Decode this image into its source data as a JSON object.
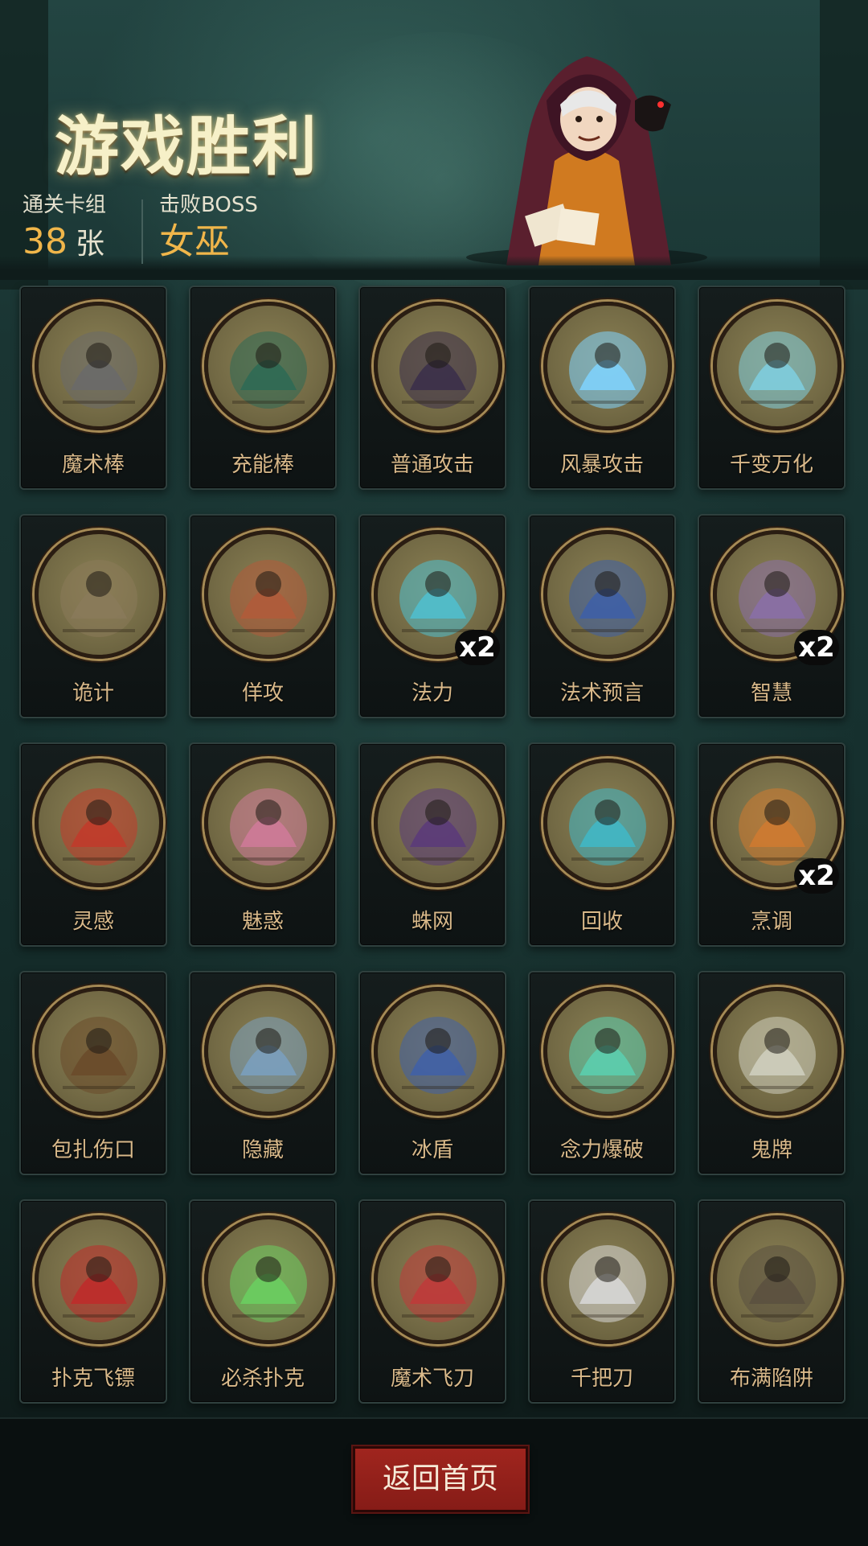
{
  "header": {
    "title": "游戏胜利",
    "cleared_label": "通关卡组",
    "cleared_count": "38",
    "cleared_unit": "张",
    "boss_label": "击败BOSS",
    "boss_name": "女巫"
  },
  "cards": [
    {
      "name": "魔术棒",
      "icon": "mace-icon",
      "tint": "#6a6a6a"
    },
    {
      "name": "充能棒",
      "icon": "wand-icon",
      "tint": "#2d6a55"
    },
    {
      "name": "普通攻击",
      "icon": "feather-slash-icon",
      "tint": "#3a2e4a"
    },
    {
      "name": "风暴攻击",
      "icon": "lightning-storm-icon",
      "tint": "#7fd4ff"
    },
    {
      "name": "千变万化",
      "icon": "voodoo-dolls-icon",
      "tint": "#7fcfe0"
    },
    {
      "name": "诡计",
      "icon": "card-players-icon",
      "tint": "#8a7a5a"
    },
    {
      "name": "佯攻",
      "icon": "hooded-swordsman-icon",
      "tint": "#b25a3a"
    },
    {
      "name": "法力",
      "icon": "mana-orb-icon",
      "tint": "#4fc0d0",
      "badge": "x2"
    },
    {
      "name": "法术预言",
      "icon": "crystal-ball-icon",
      "tint": "#3d5fa8"
    },
    {
      "name": "智慧",
      "icon": "old-sage-icon",
      "tint": "#8a6fa8",
      "badge": "x2"
    },
    {
      "name": "灵感",
      "icon": "flaming-skull-icon",
      "tint": "#c23a2a"
    },
    {
      "name": "魅惑",
      "icon": "charmed-creature-icon",
      "tint": "#d07a9a"
    },
    {
      "name": "蛛网",
      "icon": "spider-web-icon",
      "tint": "#5a3a7a"
    },
    {
      "name": "回收",
      "icon": "whirlwind-icon",
      "tint": "#3fb8c8"
    },
    {
      "name": "烹调",
      "icon": "fox-cook-icon",
      "tint": "#d07a30",
      "badge": "x2"
    },
    {
      "name": "包扎伤口",
      "icon": "plague-doctor-icon",
      "tint": "#6a4a2a"
    },
    {
      "name": "隐藏",
      "icon": "hidden-door-icon",
      "tint": "#7aa0c0"
    },
    {
      "name": "冰盾",
      "icon": "ice-wizard-icon",
      "tint": "#4060a8"
    },
    {
      "name": "念力爆破",
      "icon": "psychic-blast-icon",
      "tint": "#5ad0b0"
    },
    {
      "name": "鬼牌",
      "icon": "skull-card-icon",
      "tint": "#d0d0c0"
    },
    {
      "name": "扑克飞镖",
      "icon": "card-dart-icon",
      "tint": "#c02a2a"
    },
    {
      "name": "必杀扑克",
      "icon": "card-magician-icon",
      "tint": "#6ad060"
    },
    {
      "name": "魔术飞刀",
      "icon": "clown-knives-icon",
      "tint": "#c03a3a"
    },
    {
      "name": "千把刀",
      "icon": "thousand-knives-icon",
      "tint": "#d8d8d8"
    },
    {
      "name": "布满陷阱",
      "icon": "spike-trap-icon",
      "tint": "#5a5040"
    }
  ],
  "footer": {
    "home_label": "返回首页"
  },
  "colors": {
    "accent": "#f0b64a",
    "card_name": "#d9b98a",
    "button_red": "#a0251e"
  }
}
